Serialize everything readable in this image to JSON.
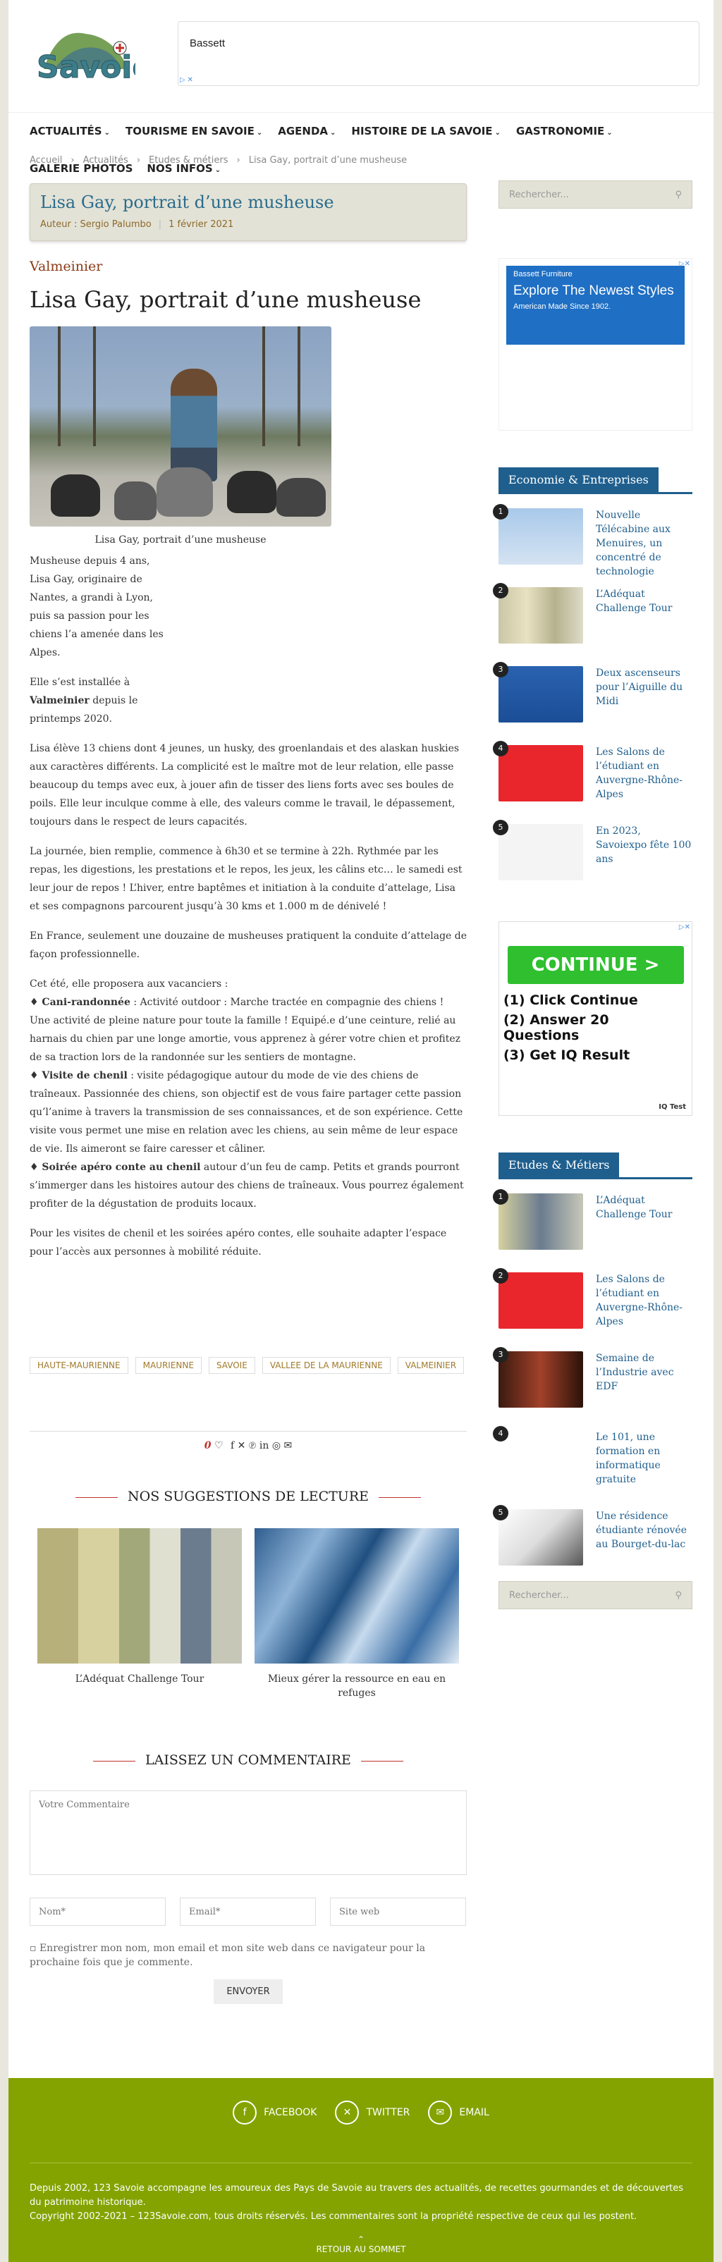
{
  "header": {
    "logo_text": "Savoie",
    "ad_text": "Bassett"
  },
  "nav": {
    "items": [
      "ACTUALITÉS",
      "TOURISME EN SAVOIE",
      "AGENDA",
      "HISTOIRE DE LA SAVOIE",
      "GASTRONOMIE"
    ],
    "items2": [
      "GALERIE PHOTOS",
      "NOS INFOS"
    ]
  },
  "breadcrumb": [
    "Accueil",
    "Actualités",
    "Etudes & métiers",
    "Lisa Gay, portrait d’une musheuse"
  ],
  "titlebox": {
    "title": "Lisa Gay, portrait d’une musheuse",
    "author": "Auteur : Sergio Palumbo",
    "date": "1 février 2021"
  },
  "article": {
    "category": "Valmeinier",
    "title": "Lisa Gay, portrait d’une musheuse",
    "caption": "Lisa Gay, portrait d’une musheuse",
    "p1": "Musheuse depuis 4 ans, Lisa Gay, originaire de Nantes, a grandi à Lyon, puis sa passion pour les chiens l’a amenée dans les Alpes.",
    "p2a": "Elle s’est installée à ",
    "p2b": "Valmeinier",
    "p2c": " depuis le printemps 2020.",
    "p3": "Lisa élève 13 chiens dont 4 jeunes, un husky, des groenlandais et des alaskan huskies aux caractères différents. La complicité est le maître mot de leur relation, elle passe beaucoup du temps avec eux, à jouer afin de tisser des liens forts avec ses boules de poils. Elle leur inculque comme à elle, des valeurs comme le travail, le dépassement, toujours dans le respect de leurs capacités.",
    "p4": "La journée, bien remplie, commence à 6h30 et se termine à 22h. Rythmée par les repas, les digestions, les prestations et le repos, les jeux, les câlins etc… le samedi est leur jour de repos ! L’hiver, entre baptêmes et initiation à la conduite d’attelage, Lisa et ses compagnons parcourent jusqu’à 30 kms et 1.000 m de dénivelé !",
    "p5": "En France, seulement une douzaine de musheuses pratiquent la conduite d’attelage de façon professionnelle.",
    "p6": "Cet été, elle proposera aux vacanciers :",
    "b1t": "♦ Cani-randonnée",
    "b1": " : Activité outdoor : Marche tractée en compagnie des chiens ! Une activité de pleine nature pour toute la famille ! Equipé.e d’une ceinture, relié au harnais du chien par une longe amortie, vous apprenez à gérer votre chien et profitez de sa traction lors de la randonnée sur les sentiers de montagne.",
    "b2t": "♦ Visite de chenil",
    "b2": " : visite pédagogique autour du mode de vie des chiens de traîneaux. Passionnée des chiens, son objectif est de vous faire partager cette passion qu’l’anime à travers la transmission de ses connaissances, et de son expérience. Cette visite vous permet une mise en relation avec les chiens, au sein même de leur espace de vie. Ils aimeront se faire caresser et câliner.",
    "b3t": "♦ Soirée apéro conte au chenil",
    "b3": " autour d’un feu de camp. Petits et grands pourront s’immerger dans les histoires autour des chiens de traîneaux. Vous pourrez également profiter de la dégustation de produits locaux.",
    "p7": "Pour les visites de chenil et les soirées apéro contes, elle souhaite adapter l’espace pour l’accès aux personnes à mobilité réduite."
  },
  "tags": [
    "HAUTE-MAURIENNE",
    "MAURIENNE",
    "SAVOIE",
    "VALLEE DE LA MAURIENNE",
    "VALMEINIER"
  ],
  "share": {
    "count": "0"
  },
  "suggestions": {
    "heading": "NOS SUGGESTIONS DE LECTURE",
    "items": [
      "L’Adéquat Challenge Tour",
      "Mieux gérer la ressource en eau en refuges"
    ]
  },
  "comment": {
    "heading": "LAISSEZ UN COMMENTAIRE",
    "textarea_placeholder": "Votre Commentaire",
    "name_placeholder": "Nom*",
    "email_placeholder": "Email*",
    "site_placeholder": "Site web",
    "remember": "Enregistrer mon nom, mon email et mon site web dans ce navigateur pour la prochaine fois que je commente.",
    "send": "ENVOYER"
  },
  "sidebar": {
    "search_placeholder": "Rechercher...",
    "ad2": {
      "brand": "Bassett Furniture",
      "headline": "Explore The Newest Styles",
      "sub": "American Made Since 1902."
    },
    "w1": {
      "heading": "Economie & Entreprises",
      "items": [
        {
          "n": "1",
          "title": "Nouvelle Télécabine aux Menuires, un concentré de technologie"
        },
        {
          "n": "2",
          "title": "L’Adéquat Challenge Tour"
        },
        {
          "n": "3",
          "title": "Deux ascenseurs pour l’Aiguille du Midi"
        },
        {
          "n": "4",
          "title": "Les Salons de l’étudiant en Auvergne-Rhône-Alpes"
        },
        {
          "n": "5",
          "title": "En 2023, Savoiexpo fête 100 ans"
        }
      ]
    },
    "ad3": {
      "cta": "CONTINUE >",
      "l1": "(1) Click Continue",
      "l2": "(2) Answer 20 Questions",
      "l3": "(3) Get IQ Result",
      "brand": "IQ Test"
    },
    "w2": {
      "heading": "Etudes & Métiers",
      "items": [
        {
          "n": "1",
          "title": "L’Adéquat Challenge Tour"
        },
        {
          "n": "2",
          "title": "Les Salons de l’étudiant en Auvergne-Rhône-Alpes"
        },
        {
          "n": "3",
          "title": "Semaine de l’Industrie avec EDF"
        },
        {
          "n": "4",
          "title": "Le 101, une formation en informatique gratuite"
        },
        {
          "n": "5",
          "title": "Une résidence étudiante rénovée au Bourget-du-lac"
        }
      ]
    }
  },
  "footer": {
    "social": [
      "FACEBOOK",
      "TWITTER",
      "EMAIL"
    ],
    "about": "Depuis 2002, 123 Savoie accompagne les amoureux des Pays de Savoie au travers des actualités, de recettes gourmandes et de découvertes du patrimoine historique.",
    "copyright": "Copyright 2002-2021 – 123Savoie.com, tous droits réservés. Les commentaires sont la propriété respective de ceux qui les postent.",
    "totop": "RETOUR AU SOMMET"
  }
}
